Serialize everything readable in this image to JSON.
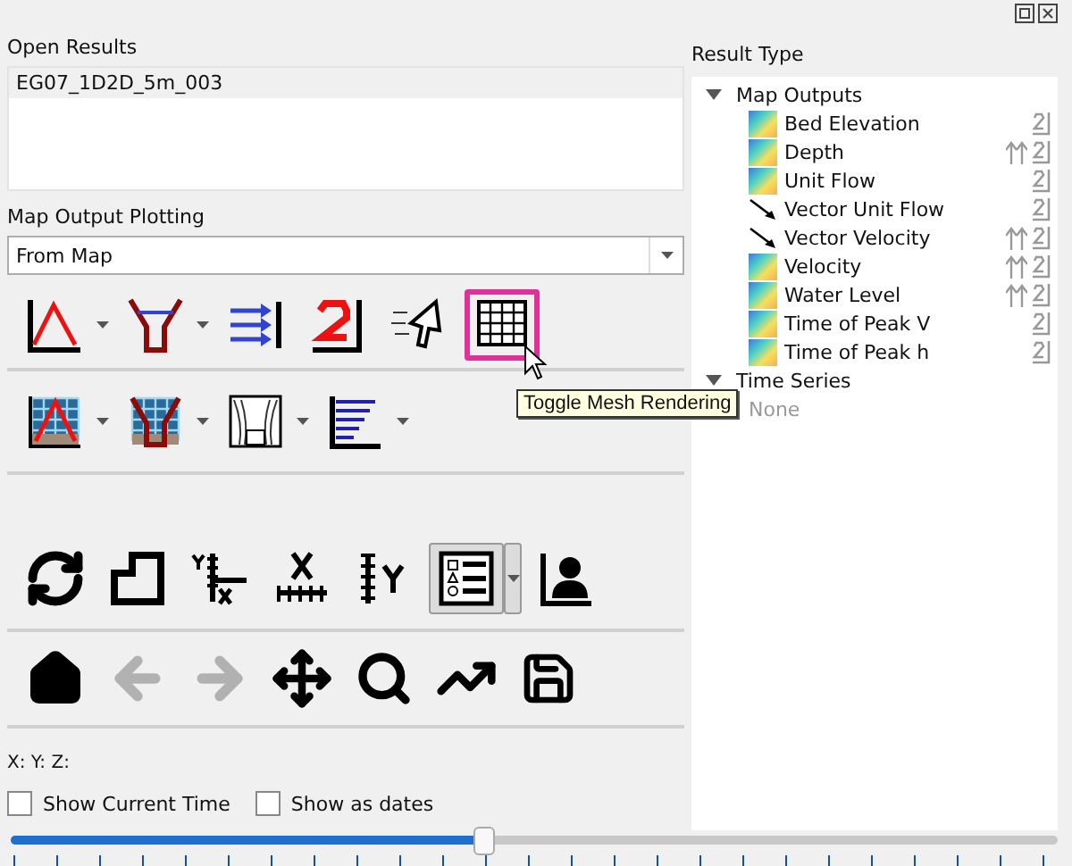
{
  "open_results": {
    "label": "Open Results",
    "items": [
      {
        "name": "EG07_1D2D_5m_003",
        "selected": false
      }
    ]
  },
  "map_output_plotting": {
    "label": "Map Output Plotting",
    "value": "From Map"
  },
  "toolbars": [
    {
      "buttons": [
        {
          "kind": "profile",
          "highlighted": false
        },
        {
          "kind": "dropdown",
          "highlighted": false
        },
        {
          "kind": "section",
          "highlighted": false
        },
        {
          "kind": "dropdown",
          "highlighted": false
        },
        {
          "kind": "flow",
          "highlighted": false
        },
        {
          "kind": "hydro",
          "highlighted": false
        },
        {
          "kind": "pointer",
          "highlighted": false
        },
        {
          "kind": "mesh",
          "highlighted": true
        }
      ]
    },
    {
      "buttons": [
        {
          "kind": "mesh_profile",
          "highlighted": false
        },
        {
          "kind": "dropdown",
          "highlighted": false
        },
        {
          "kind": "mesh_section",
          "highlighted": false
        },
        {
          "kind": "dropdown",
          "highlighted": false
        },
        {
          "kind": "curtain",
          "highlighted": false
        },
        {
          "kind": "dropdown",
          "highlighted": false
        },
        {
          "kind": "bars",
          "highlighted": false
        },
        {
          "kind": "dropdown",
          "highlighted": false
        }
      ]
    },
    {
      "buttons": [
        {
          "kind": "refresh",
          "pressed": false
        },
        {
          "kind": "corner",
          "pressed": false
        },
        {
          "kind": "axes_xy",
          "pressed": false
        },
        {
          "kind": "axis_x",
          "pressed": false
        },
        {
          "kind": "axis_y",
          "pressed": false
        },
        {
          "kind": "legend",
          "pressed": true
        },
        {
          "kind": "dropdown",
          "pressed": true
        },
        {
          "kind": "user",
          "pressed": false
        }
      ]
    },
    {
      "buttons": [
        {
          "kind": "home",
          "disabled": false
        },
        {
          "kind": "back",
          "disabled": true
        },
        {
          "kind": "forward",
          "disabled": true
        },
        {
          "kind": "move",
          "disabled": false
        },
        {
          "kind": "search",
          "disabled": false
        },
        {
          "kind": "trend",
          "disabled": false
        },
        {
          "kind": "save",
          "disabled": false
        }
      ]
    }
  ],
  "tooltip": {
    "text": "Toggle Mesh Rendering"
  },
  "coordinates": "X:  Y:  Z:",
  "checkboxes": [
    {
      "label": "Show Current Time",
      "checked": false
    },
    {
      "label": "Show as dates",
      "checked": false
    }
  ],
  "time_slider": {
    "level": 0.45
  },
  "result_type": {
    "label": "Result Type",
    "tree": [
      {
        "name": "Map Outputs",
        "expanded": true,
        "children": [
          {
            "name": "Bed Elevation",
            "kind": "scalar",
            "max": false
          },
          {
            "name": "Depth",
            "kind": "scalar",
            "max": true
          },
          {
            "name": "Unit Flow",
            "kind": "scalar",
            "max": false
          },
          {
            "name": "Vector Unit Flow",
            "kind": "vector",
            "max": false
          },
          {
            "name": "Vector Velocity",
            "kind": "vector",
            "max": true
          },
          {
            "name": "Velocity",
            "kind": "scalar",
            "max": true
          },
          {
            "name": "Water Level",
            "kind": "scalar",
            "max": true
          },
          {
            "name": "Time of Peak V",
            "kind": "scalar",
            "max": false
          },
          {
            "name": "Time of Peak h",
            "kind": "scalar",
            "max": false
          }
        ]
      },
      {
        "name": "Time Series",
        "expanded": true,
        "children": [
          {
            "name": "None",
            "kind": "empty"
          }
        ]
      }
    ]
  }
}
